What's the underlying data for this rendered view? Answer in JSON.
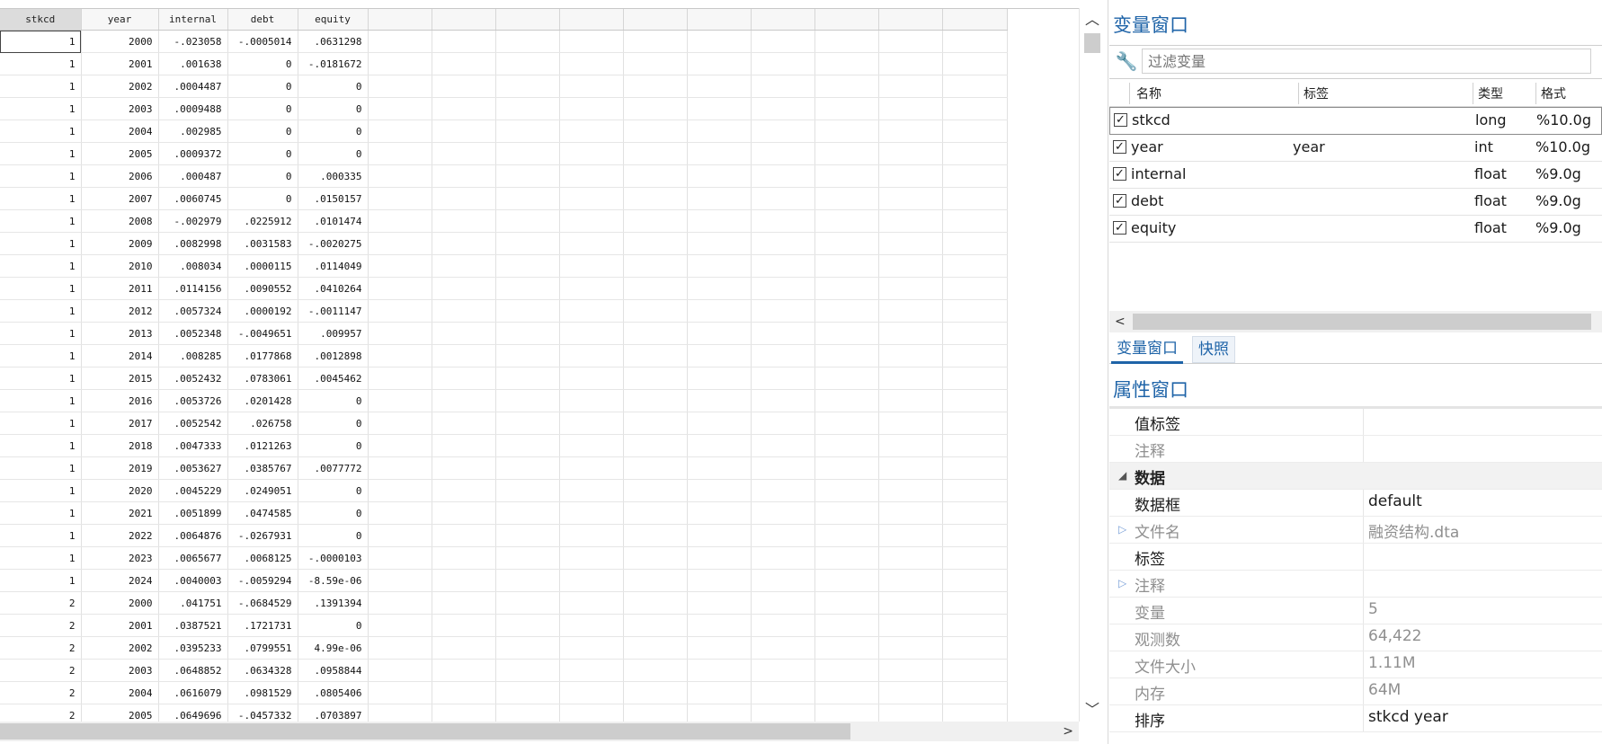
{
  "data_editor": {
    "columns": [
      "stkcd",
      "year",
      "internal",
      "debt",
      "equity"
    ],
    "rows": [
      [
        "1",
        "2000",
        "-.023058",
        "-.0005014",
        ".0631298"
      ],
      [
        "1",
        "2001",
        ".001638",
        "0",
        "-.0181672"
      ],
      [
        "1",
        "2002",
        ".0004487",
        "0",
        "0"
      ],
      [
        "1",
        "2003",
        ".0009488",
        "0",
        "0"
      ],
      [
        "1",
        "2004",
        ".002985",
        "0",
        "0"
      ],
      [
        "1",
        "2005",
        ".0009372",
        "0",
        "0"
      ],
      [
        "1",
        "2006",
        ".000487",
        "0",
        ".000335"
      ],
      [
        "1",
        "2007",
        ".0060745",
        "0",
        ".0150157"
      ],
      [
        "1",
        "2008",
        "-.002979",
        ".0225912",
        ".0101474"
      ],
      [
        "1",
        "2009",
        ".0082998",
        ".0031583",
        "-.0020275"
      ],
      [
        "1",
        "2010",
        ".008034",
        ".0000115",
        ".0114049"
      ],
      [
        "1",
        "2011",
        ".0114156",
        ".0090552",
        ".0410264"
      ],
      [
        "1",
        "2012",
        ".0057324",
        ".0000192",
        "-.0011147"
      ],
      [
        "1",
        "2013",
        ".0052348",
        "-.0049651",
        ".009957"
      ],
      [
        "1",
        "2014",
        ".008285",
        ".0177868",
        ".0012898"
      ],
      [
        "1",
        "2015",
        ".0052432",
        ".0783061",
        ".0045462"
      ],
      [
        "1",
        "2016",
        ".0053726",
        ".0201428",
        "0"
      ],
      [
        "1",
        "2017",
        ".0052542",
        ".026758",
        "0"
      ],
      [
        "1",
        "2018",
        ".0047333",
        ".0121263",
        "0"
      ],
      [
        "1",
        "2019",
        ".0053627",
        ".0385767",
        ".0077772"
      ],
      [
        "1",
        "2020",
        ".0045229",
        ".0249051",
        "0"
      ],
      [
        "1",
        "2021",
        ".0051899",
        ".0474585",
        "0"
      ],
      [
        "1",
        "2022",
        ".0064876",
        "-.0267931",
        "0"
      ],
      [
        "1",
        "2023",
        ".0065677",
        ".0068125",
        "-.0000103"
      ],
      [
        "1",
        "2024",
        ".0040003",
        "-.0059294",
        "-8.59e-06"
      ],
      [
        "2",
        "2000",
        ".041751",
        "-.0684529",
        ".1391394"
      ],
      [
        "2",
        "2001",
        ".0387521",
        ".1721731",
        "0"
      ],
      [
        "2",
        "2002",
        ".0395233",
        ".0799551",
        "4.99e-06"
      ],
      [
        "2",
        "2003",
        ".0648852",
        ".0634328",
        ".0958844"
      ],
      [
        "2",
        "2004",
        ".0616079",
        ".0981529",
        ".0805406"
      ],
      [
        "2",
        "2005",
        ".0649696",
        "-.0457332",
        ".0703897"
      ]
    ]
  },
  "variable_window": {
    "title": "变量窗口",
    "filter_placeholder": "过滤变量",
    "headers": {
      "name": "名称",
      "label": "标签",
      "type": "类型",
      "format": "格式"
    },
    "variables": [
      {
        "name": "stkcd",
        "label": "",
        "type": "long",
        "format": "%10.0g",
        "checked": true
      },
      {
        "name": "year",
        "label": "year",
        "type": "int",
        "format": "%10.0g",
        "checked": true
      },
      {
        "name": "internal",
        "label": "",
        "type": "float",
        "format": "%9.0g",
        "checked": true
      },
      {
        "name": "debt",
        "label": "",
        "type": "float",
        "format": "%9.0g",
        "checked": true
      },
      {
        "name": "equity",
        "label": "",
        "type": "float",
        "format": "%9.0g",
        "checked": true
      }
    ]
  },
  "tabs": {
    "variables": "变量窗口",
    "snapshots": "快照"
  },
  "properties_window": {
    "title": "属性窗口",
    "rows": [
      {
        "key": "值标签",
        "value": "",
        "style": "normal",
        "tri": ""
      },
      {
        "key": "注释",
        "value": "",
        "style": "grey",
        "tri": ""
      },
      {
        "key": "数据",
        "value": "",
        "style": "section",
        "tri": "◢"
      },
      {
        "key": "数据框",
        "value": "default",
        "style": "normal",
        "tri": ""
      },
      {
        "key": "文件名",
        "value": "融资结构.dta",
        "style": "grey",
        "tri": "▷"
      },
      {
        "key": "标签",
        "value": "",
        "style": "normal",
        "tri": ""
      },
      {
        "key": "注释",
        "value": "",
        "style": "grey",
        "tri": "▷"
      },
      {
        "key": "变量",
        "value": "5",
        "style": "grey",
        "tri": ""
      },
      {
        "key": "观测数",
        "value": "64,422",
        "style": "grey",
        "tri": ""
      },
      {
        "key": "文件大小",
        "value": "1.11M",
        "style": "grey",
        "tri": ""
      },
      {
        "key": "内存",
        "value": "64M",
        "style": "grey",
        "tri": ""
      },
      {
        "key": "排序",
        "value": "stkcd year",
        "style": "normal",
        "tri": ""
      }
    ]
  }
}
